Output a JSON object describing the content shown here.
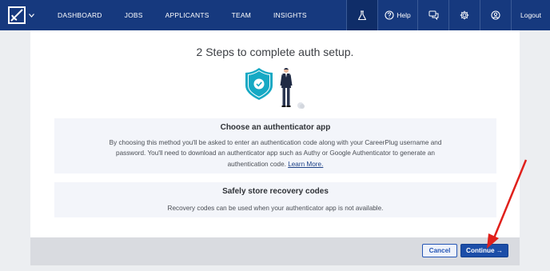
{
  "nav": {
    "links": [
      "DASHBOARD",
      "JOBS",
      "APPLICANTS",
      "TEAM",
      "INSIGHTS"
    ],
    "help_label": "Help",
    "logout_label": "Logout",
    "icons": [
      "logo-icon",
      "chevron-down-icon",
      "flask-icon",
      "question-circle-icon",
      "chat-bubbles-icon",
      "gear-icon",
      "user-circle-icon"
    ]
  },
  "page": {
    "title": "2 Steps to complete auth setup."
  },
  "step1": {
    "title": "Choose an authenticator app",
    "body": "By choosing this method you'll be asked to enter an authentication code along with your CareerPlug username and password. You'll need to download an authenticator app such as Authy or Google Authenticator to generate an authentication code.",
    "link": "Learn More."
  },
  "step2": {
    "title": "Safely store recovery codes",
    "body": "Recovery codes can be used when your authenticator app is not available."
  },
  "actions": {
    "cancel_label": "Cancel",
    "continue_label": "Continue →"
  },
  "colors": {
    "navbar": "#16397e",
    "primary": "#1c4ea8",
    "shield": "#16a9c4",
    "annotation_arrow": "#e0201b"
  }
}
